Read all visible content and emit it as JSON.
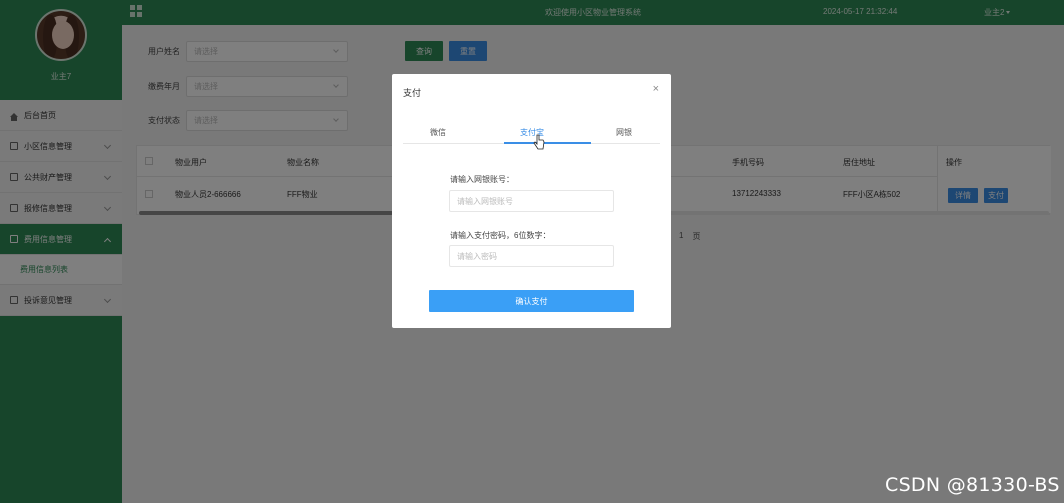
{
  "sidebar": {
    "username": "业主7",
    "items": [
      {
        "label": "后台首页"
      },
      {
        "label": "小区信息管理"
      },
      {
        "label": "公共财产管理"
      },
      {
        "label": "报修信息管理"
      },
      {
        "label": "费用信息管理"
      },
      {
        "label": "投诉意见管理"
      }
    ],
    "submenu_label": "费用信息列表"
  },
  "topbar": {
    "title": "欢迎使用小区物业管理系统",
    "datetime": "2024-05-17 21:32:44",
    "user": "业主2"
  },
  "filters": {
    "user_label": "用户姓名",
    "user_placeholder": "请选择",
    "month_label": "缴费年月",
    "month_placeholder": "请选择",
    "status_label": "支付状态",
    "status_placeholder": "请选择",
    "query_label": "查询",
    "reset_label": "重置"
  },
  "table": {
    "headers": {
      "user": "物业用户",
      "property": "物业名称",
      "phone": "手机号码",
      "address": "居住地址",
      "op": "操作"
    },
    "row": {
      "user": "物业人员2-666666",
      "property": "FFF物业",
      "phone": "13712243333",
      "address": "FFF小区A栋502",
      "detail": "详情",
      "pay": "支付"
    }
  },
  "pager": {
    "page": "1",
    "unit": "页"
  },
  "modal": {
    "title": "支付",
    "close": "×",
    "tabs": [
      "微信",
      "支付宝",
      "网银"
    ],
    "active_tab": 1,
    "account_label": "请输入网银账号：",
    "account_placeholder": "请输入网银账号",
    "password_label": "请输入支付密码，6位数字：",
    "password_placeholder": "请输入密码",
    "confirm_label": "确认支付"
  },
  "watermark": "CSDN @81330-BS",
  "colors": {
    "primary": "#2e8b57",
    "accent": "#3a8ee6",
    "confirm": "#3a9ff6"
  }
}
